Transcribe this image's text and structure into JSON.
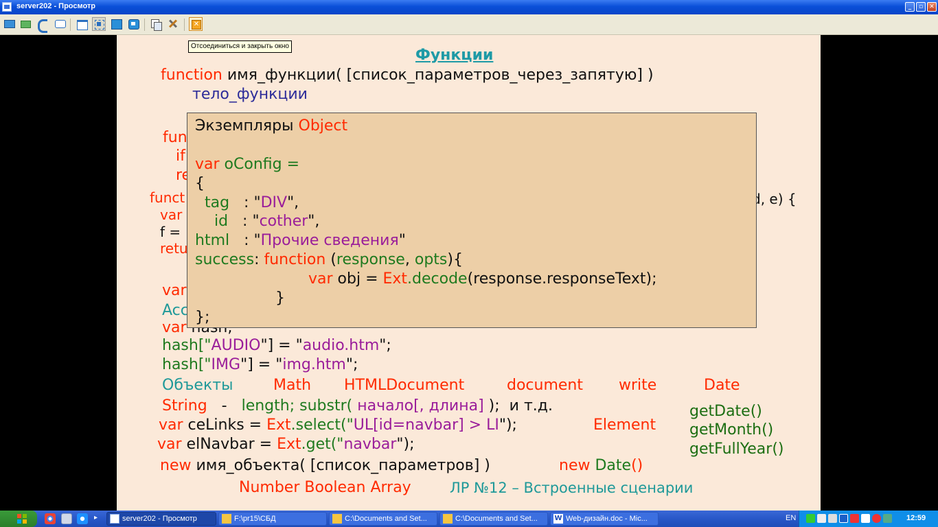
{
  "window": {
    "title": "server202 - Просмотр"
  },
  "toolbar": {
    "tooltip": "Отсоединиться и закрыть окно",
    "buttons": [
      "send-screen-icon",
      "refresh-icon",
      "phone-icon",
      "chat-icon",
      "window-mode-icon",
      "fit-screen-icon",
      "fullscreen-icon",
      "scale-icon",
      "clipboard-icon",
      "settings-icon",
      "disconnect-icon"
    ]
  },
  "slide": {
    "title": "Функции",
    "lines": {
      "l1_kw": "function",
      "l1_rest": " имя_функции( [список_параметров_через_запятую] )",
      "l2": "тело_функции",
      "fn_partial_1": "fun",
      "fn_partial_2": "if",
      "fn_partial_3": "re",
      "fn_partial_4": "funct",
      "fn_tail": "d, e) {",
      "var_partial_1": "var",
      "f_partial": "f =",
      "ret_partial": "retu",
      "var_partial_2": "var",
      "acc_partial": "Acc",
      "varhash_kw": "var",
      "varhash_rest": " hash;",
      "hash1_a": "hash[\"",
      "hash1_b": "AUDIO",
      "hash1_c": "\"] = \"",
      "hash1_d": "audio.htm",
      "hash1_e": "\";",
      "hash2_a": "hash[\"",
      "hash2_b": "IMG",
      "hash2_c": "\"] = \"",
      "hash2_d": "img.htm",
      "hash2_e": "\";",
      "objects_label": "Объекты",
      "obj_math": "Math",
      "obj_htmldoc": "HTMLDocument",
      "obj_document": "document",
      "obj_write": "write",
      "obj_date": "Date",
      "string_label": "String",
      "string_dash": "-",
      "string_methods": "length; substr(",
      "string_params": "начало[, длина]",
      "string_end": " );  и т.д.",
      "celinks_kw": "var",
      "celinks_name": " ceLinks = ",
      "celinks_ext": "Ext",
      "celinks_call": ".select(\"",
      "celinks_arg": "UL[id=navbar] > LI",
      "celinks_end": "\");",
      "element_label": "Element",
      "elnav_kw": "var",
      "elnav_name": " elNavbar = ",
      "elnav_ext": "Ext",
      "elnav_call": ".get(\"",
      "elnav_arg": "navbar",
      "elnav_end": "\");",
      "new_kw": "new",
      "new_rest": " имя_объекта( [список_параметров] )",
      "new_date_kw": "new",
      "new_date": " Date",
      "new_date_paren": "()",
      "get_date": "getDate()",
      "get_month": "getMonth()",
      "get_fullyear": "getFullYear()",
      "footer_types": "Number Boolean Array",
      "footer_lab": "ЛР №12 – Встроенные сценарии"
    }
  },
  "popup": {
    "heading_a": "Экземпляры ",
    "heading_b": "Object",
    "var_kw": "var",
    "var_name": " oConfig =",
    "open_brace": "{",
    "tag_key": "  tag",
    "tag_sep": "   : \"",
    "tag_val": "DIV",
    "tag_end": "\",",
    "id_key": "    id",
    "id_sep": "   : \"",
    "id_val": "cother",
    "id_end": "\",",
    "html_key": "html",
    "html_sep": "   : \"",
    "html_val": "Прочие сведения",
    "html_end": "\"",
    "success_key": "success",
    "success_sep": ": ",
    "success_fn": "function",
    "success_paren_open": " (",
    "success_p1": "response",
    "success_comma": ", ",
    "success_p2": "opts",
    "success_close": "){",
    "body_kw": "var",
    "body_name": " obj = ",
    "body_ext": "Ext",
    "body_call": ".decode",
    "body_args": "(response.responseText);",
    "inner_close": "}",
    "close": "};"
  },
  "taskbar": {
    "tasks": [
      "server202 - Просмотр",
      "F:\\pr15\\СБД",
      "C:\\Documents and Set...",
      "C:\\Documents and Set...",
      "Web-дизайн.doc - Mic..."
    ],
    "lang": "EN",
    "clock": "12:59"
  }
}
